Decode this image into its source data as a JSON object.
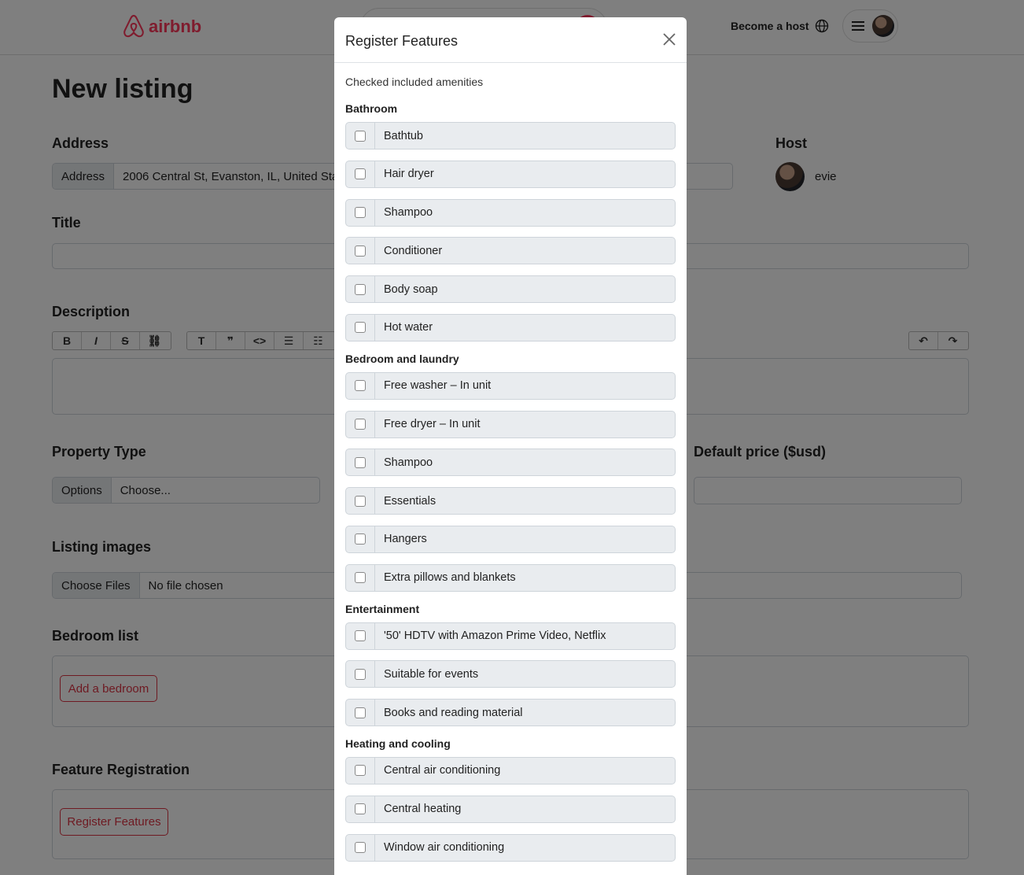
{
  "header": {
    "brand": "airbnb",
    "become_host": "Become a host"
  },
  "page": {
    "title": "New listing",
    "address_label": "Address",
    "address_addon": "Address",
    "address_value": "2006 Central St, Evanston, IL, United States",
    "host_label": "Host",
    "host_name": "evie",
    "title_label": "Title",
    "description_label": "Description",
    "property_type_label": "Property Type",
    "property_addon": "Options",
    "property_value": "Choose...",
    "default_price_label": "Default price ($usd)",
    "images_label": "Listing images",
    "choose_files": "Choose Files",
    "no_file": "No file chosen",
    "bedroom_list_label": "Bedroom list",
    "add_bedroom": "Add a bedroom",
    "feature_reg_label": "Feature Registration",
    "register_features_btn": "Register Features"
  },
  "modal": {
    "title": "Register Features",
    "intro": "Checked included amenities",
    "sections": [
      {
        "name": "Bathroom",
        "items": [
          "Bathtub",
          "Hair dryer",
          "Shampoo",
          "Conditioner",
          "Body soap",
          "Hot water"
        ]
      },
      {
        "name": "Bedroom and laundry",
        "items": [
          "Free washer – In unit",
          "Free dryer – In unit",
          "Shampoo",
          "Essentials",
          "Hangers",
          "Extra pillows and blankets"
        ]
      },
      {
        "name": "Entertainment",
        "items": [
          "'50' HDTV with Amazon Prime Video, Netflix",
          "Suitable for events",
          "Books and reading material"
        ]
      },
      {
        "name": "Heating and cooling",
        "items": [
          "Central air conditioning",
          "Central heating",
          "Window air conditioning"
        ]
      }
    ]
  },
  "colors": {
    "brand": "#FF385C",
    "danger": "#dc3545",
    "overlay": "rgba(0,0,0,0.5)"
  }
}
